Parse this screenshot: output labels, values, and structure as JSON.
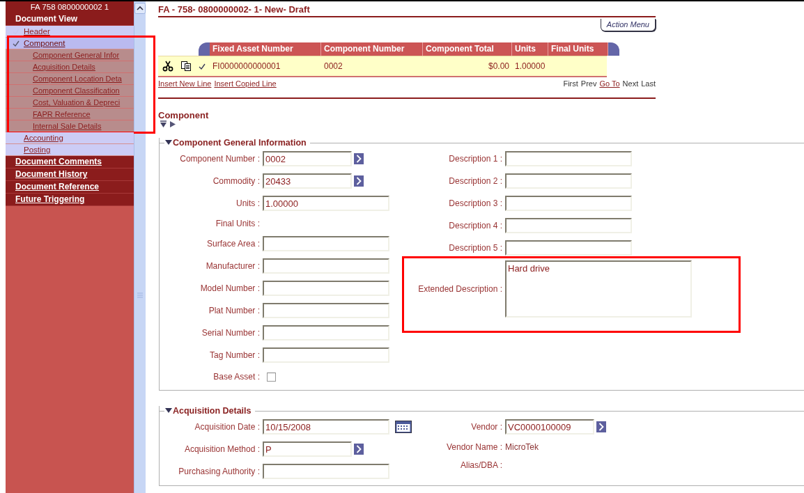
{
  "sidebar": {
    "header": "FA 758 0800000002 1",
    "sections": [
      {
        "label": "Document View",
        "expanded": true,
        "items": [
          {
            "label": "Header",
            "checked": true,
            "selected": false,
            "highlighted": false
          },
          {
            "label": "Component",
            "checked": true,
            "selected": true,
            "highlighted": true,
            "children": [
              {
                "label": "Component General Infor"
              },
              {
                "label": "Acquisition Details"
              },
              {
                "label": "Component Location Deta"
              },
              {
                "label": "Component Classification"
              },
              {
                "label": "Cost, Valuation & Depreci"
              },
              {
                "label": "FAPR Reference"
              },
              {
                "label": "Internal Sale Details"
              }
            ]
          },
          {
            "label": "Accounting",
            "checked": false,
            "selected": false,
            "highlighted": false
          },
          {
            "label": "Posting",
            "checked": false,
            "selected": false,
            "highlighted": false
          }
        ]
      },
      {
        "label": "Document Comments",
        "expanded": false
      },
      {
        "label": "Document History",
        "expanded": false
      },
      {
        "label": "Document Reference",
        "expanded": false
      },
      {
        "label": "Future Triggering",
        "expanded": false
      }
    ]
  },
  "main": {
    "title": "FA - 758- 0800000002- 1- New- Draft",
    "action_menu": "Action Menu",
    "grid": {
      "columns": [
        "Fixed Asset Number",
        "Component Number",
        "Component Total",
        "Units",
        "Final Units"
      ],
      "rows": [
        {
          "selected": true,
          "cells": [
            "FI0000000000001",
            "0002",
            "$0.00",
            "1.00000",
            ""
          ]
        }
      ],
      "links": [
        "Insert New Line",
        "Insert Copied Line"
      ],
      "pager": [
        {
          "label": "First",
          "link": false
        },
        {
          "label": "Prev",
          "link": false
        },
        {
          "label": "Go To",
          "link": true
        },
        {
          "label": "Next",
          "link": false
        },
        {
          "label": "Last",
          "link": false
        }
      ]
    },
    "section_title": "Component",
    "sections": [
      {
        "title": "Component General Information",
        "expanded": true,
        "left": [
          {
            "label": "Component Number :",
            "kind": "lookup",
            "value": "0002"
          },
          {
            "label": "Commodity :",
            "kind": "lookup",
            "value": "20433"
          },
          {
            "label": "Units :",
            "kind": "input",
            "value": "1.00000"
          },
          {
            "label": "Final Units :",
            "kind": "display"
          },
          {
            "label": "Surface Area :",
            "kind": "input"
          },
          {
            "label": "Manufacturer :",
            "kind": "input"
          },
          {
            "label": "Model Number :",
            "kind": "input"
          },
          {
            "label": "Plat Number :",
            "kind": "input"
          },
          {
            "label": "Serial Number :",
            "kind": "input"
          },
          {
            "label": "Tag Number :",
            "kind": "input"
          },
          {
            "label": "Base Asset :",
            "kind": "checkbox",
            "checked": false
          }
        ],
        "right": [
          {
            "label": "Description 1 :",
            "kind": "input"
          },
          {
            "label": "Description 2 :",
            "kind": "input"
          },
          {
            "label": "Description 3 :",
            "kind": "input"
          },
          {
            "label": "Description 4 :",
            "kind": "input"
          },
          {
            "label": "Description 5 :",
            "kind": "input"
          },
          {
            "label": "Extended Description :",
            "kind": "textarea",
            "value": "Hard drive",
            "highlighted": true
          }
        ]
      },
      {
        "title": "Acquisition Details",
        "expanded": true,
        "left": [
          {
            "label": "Acquisition Date :",
            "kind": "date",
            "value": "10/15/2008"
          },
          {
            "label": "Acquisition Method :",
            "kind": "lookup",
            "value": "P"
          },
          {
            "label": "Purchasing Authority :",
            "kind": "input"
          }
        ],
        "right": [
          {
            "label": "Vendor :",
            "kind": "lookup",
            "value": "VC0000100009"
          },
          {
            "label": "Vendor Name :",
            "kind": "display",
            "value": "MicroTek"
          },
          {
            "label": "Alias/DBA :",
            "kind": "display"
          }
        ]
      }
    ]
  }
}
